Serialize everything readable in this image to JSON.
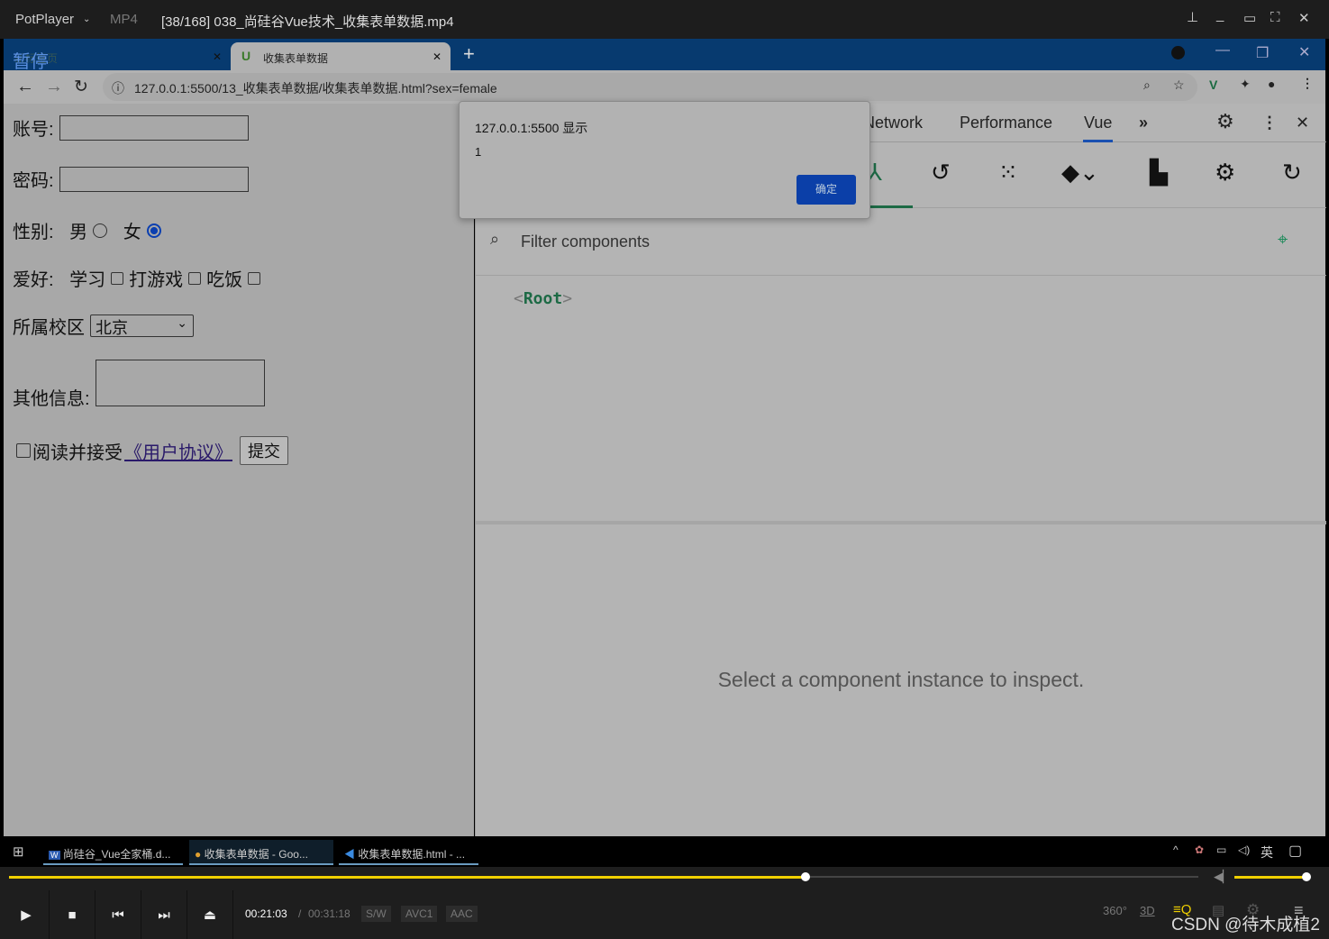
{
  "player": {
    "app": "PotPlayer",
    "format": "MP4",
    "title": "[38/168] 038_尚硅谷Vue技术_收集表单数据.mp4",
    "time_current": "00:21:03",
    "time_sep": "/",
    "time_total": "00:31:18",
    "badges": [
      "S/W",
      "AVC1",
      "AAC"
    ],
    "progress": 0.67,
    "volume": 1.0,
    "pause_overlay": "暂停",
    "watermark": "CSDN @待木成植2",
    "icons": [
      "360-icon",
      "3d-icon",
      "playlist-icon",
      "chat-icon",
      "settings-icon",
      "menu-icon"
    ],
    "accent": "#f0d000"
  },
  "browser": {
    "tabs": [
      {
        "label": "新标签页"
      },
      {
        "label": "收集表单数据"
      }
    ],
    "url": "127.0.0.1:5500/13_收集表单数据/收集表单数据.html?sex=female"
  },
  "form": {
    "account_label": "账号:",
    "password_label": "密码:",
    "gender_label": "性别:",
    "male": "男",
    "female": "女",
    "gender_selected": "female",
    "hobby_label": "爱好:",
    "hobbies": [
      "学习",
      "打游戏",
      "吃饭"
    ],
    "campus_label": "所属校区",
    "campus_value": "北京",
    "other_label": "其他信息:",
    "agree_text": "阅读并接受",
    "agreement_link": "《用户协议》",
    "submit": "提交"
  },
  "dialog": {
    "title": "127.0.0.1:5500 显示",
    "message": "1",
    "ok": "确定"
  },
  "devtools": {
    "tabs": [
      "Network",
      "Performance",
      "Vue"
    ],
    "active_tab": "Vue",
    "filter_placeholder": "Filter components",
    "root": "Root",
    "root_open": "<",
    "root_close": ">",
    "empty_message": "Select a component instance to inspect."
  },
  "taskbar": {
    "items": [
      "尚硅谷_Vue全家桶.d...",
      "收集表单数据 - Goo...",
      "收集表单数据.html - ..."
    ],
    "ime": "英"
  }
}
